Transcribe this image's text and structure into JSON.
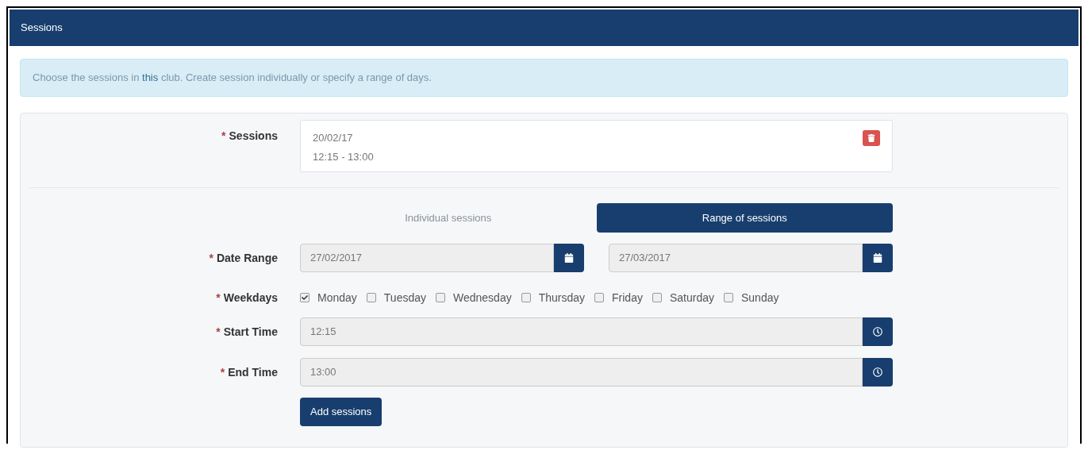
{
  "header": {
    "title": "Sessions"
  },
  "info": {
    "before": "Choose the sessions in ",
    "link": "this",
    "after": " club. Create session individually or specify a range of days."
  },
  "sessions": {
    "required_mark": "*",
    "label": "Sessions",
    "items": [
      {
        "date": "20/02/17",
        "time": "12:15 - 13:00"
      }
    ]
  },
  "tabs": [
    {
      "label": "Individual sessions",
      "selected": false
    },
    {
      "label": "Range of sessions",
      "selected": true
    }
  ],
  "date_range": {
    "required_mark": "*",
    "label": "Date Range",
    "from": "27/02/2017",
    "to": "27/03/2017"
  },
  "weekdays": {
    "required_mark": "*",
    "label": "Weekdays",
    "days": [
      {
        "label": "Monday",
        "checked": true
      },
      {
        "label": "Tuesday",
        "checked": false
      },
      {
        "label": "Wednesday",
        "checked": false
      },
      {
        "label": "Thursday",
        "checked": false
      },
      {
        "label": "Friday",
        "checked": false
      },
      {
        "label": "Saturday",
        "checked": false
      },
      {
        "label": "Sunday",
        "checked": false
      }
    ]
  },
  "start_time": {
    "required_mark": "*",
    "label": "Start Time",
    "value": "12:15"
  },
  "end_time": {
    "required_mark": "*",
    "label": "End Time",
    "value": "13:00"
  },
  "add_button": "Add sessions"
}
